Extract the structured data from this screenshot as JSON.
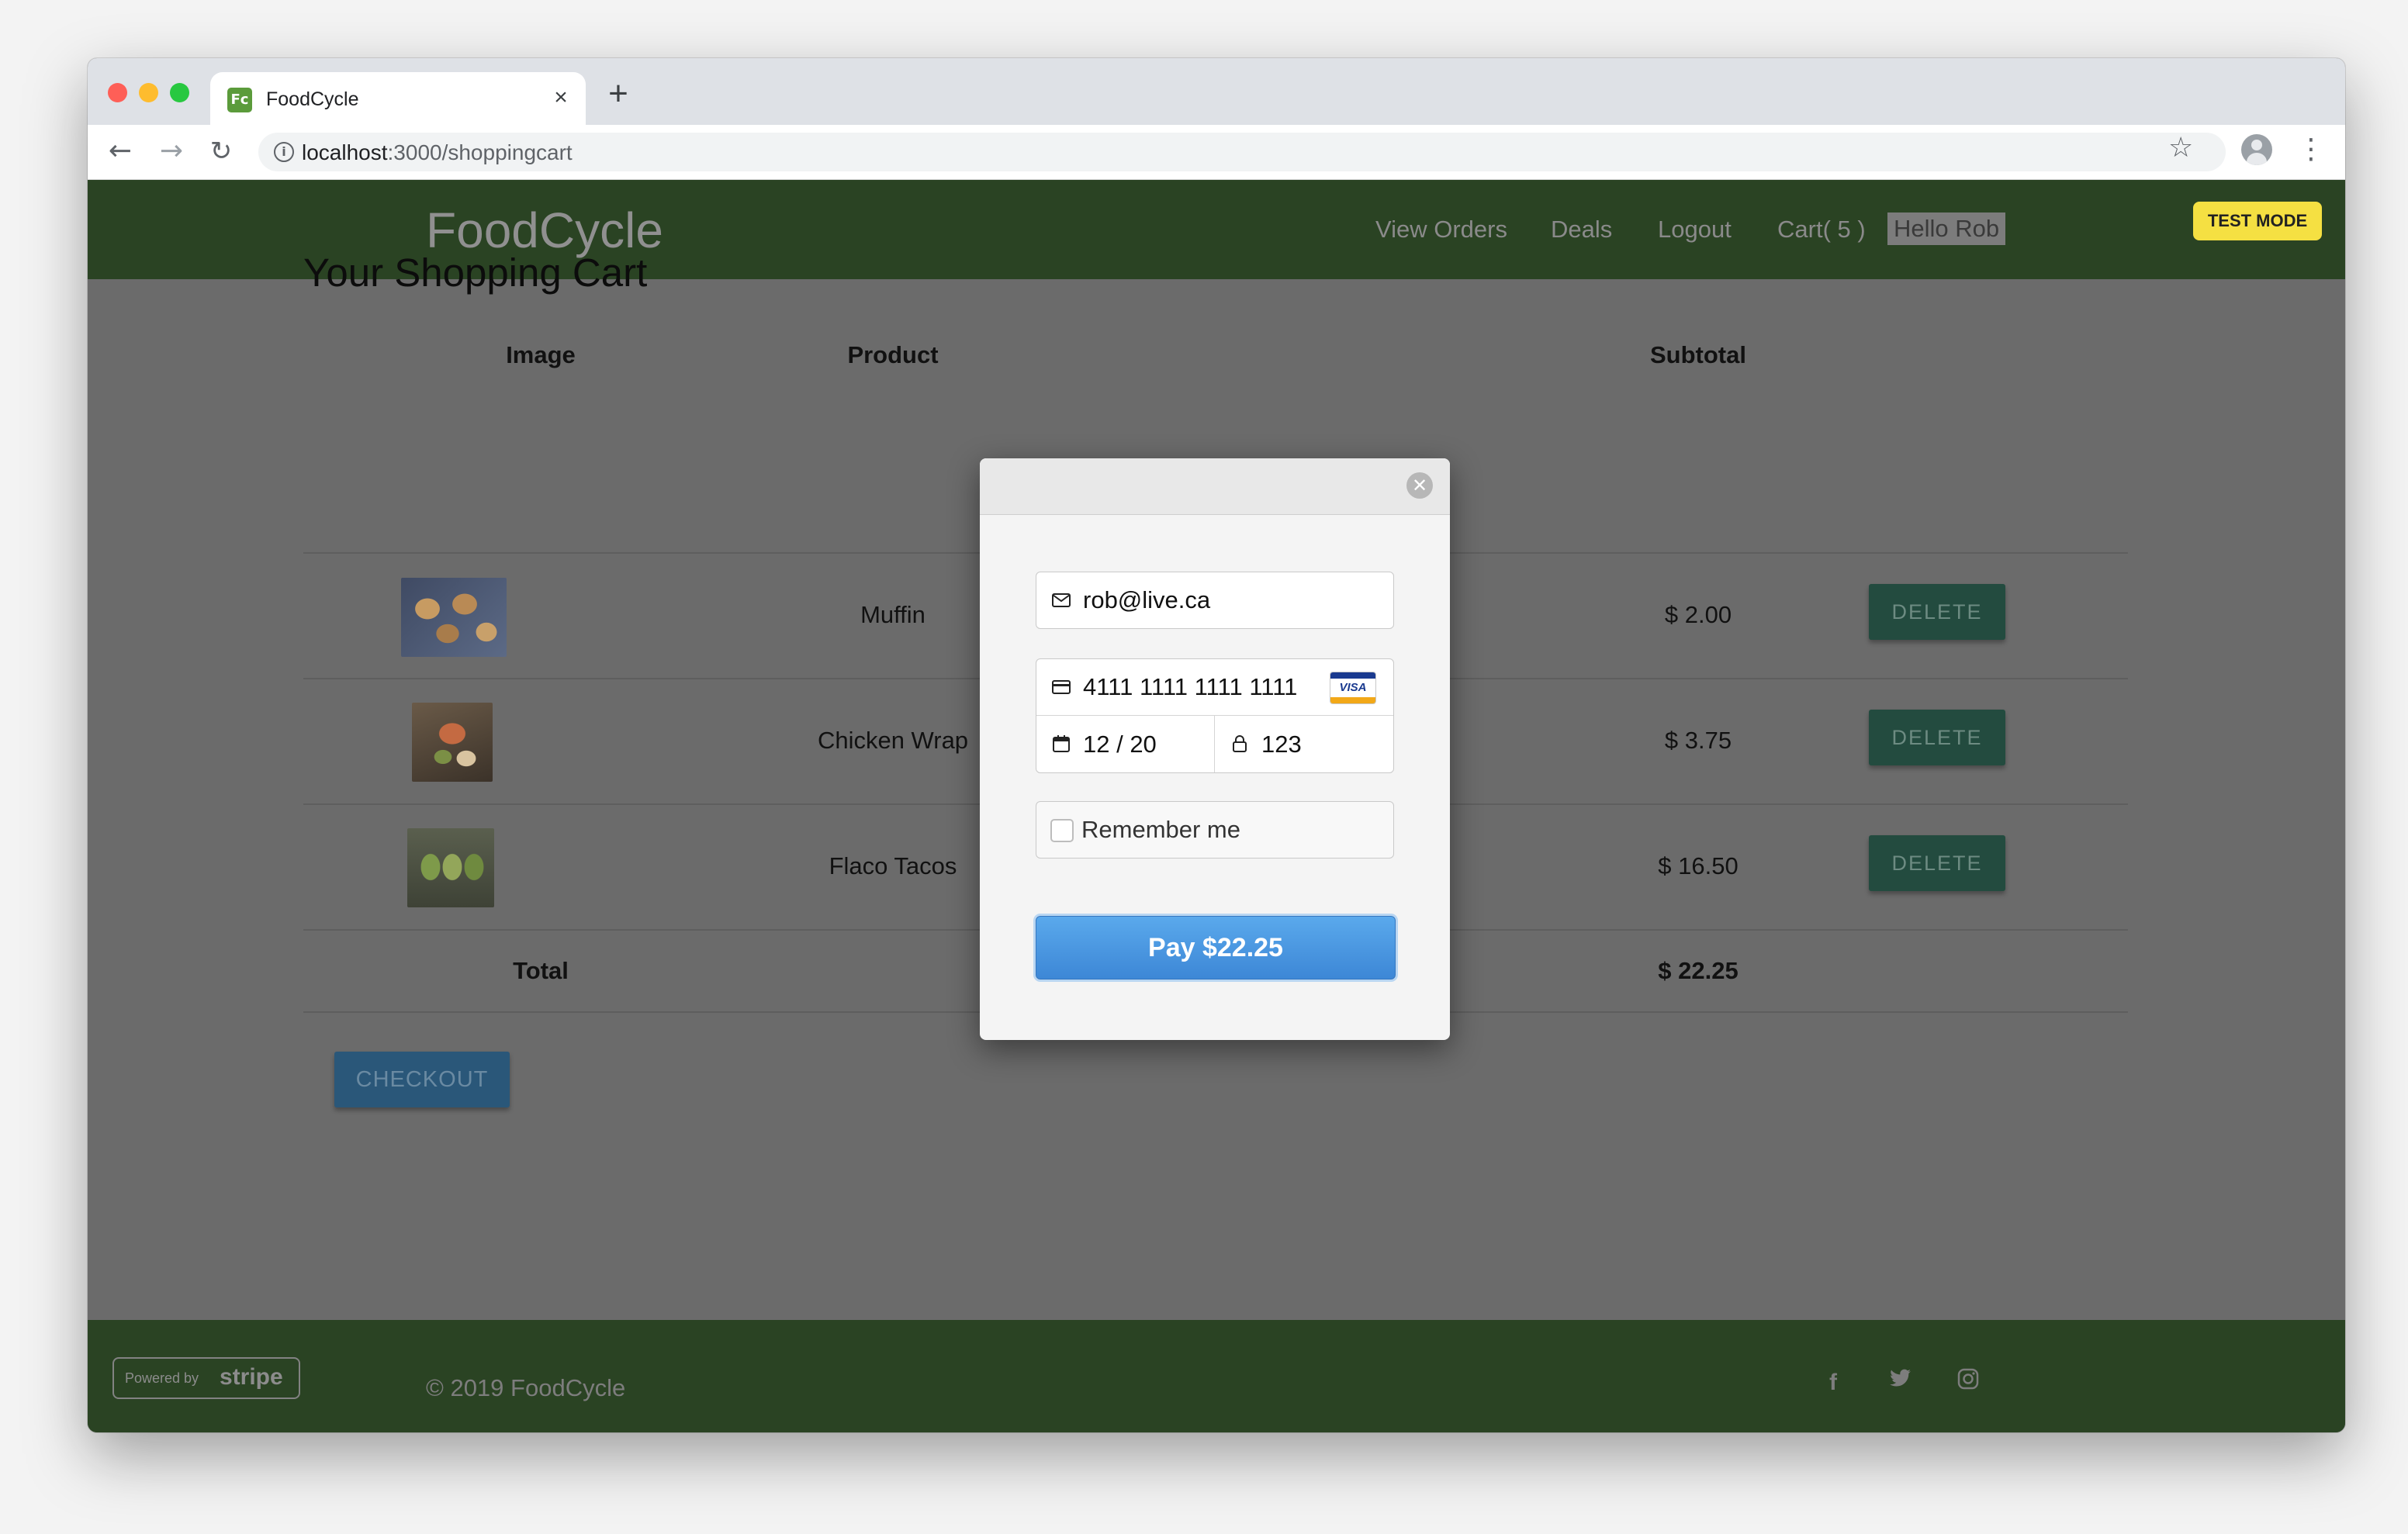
{
  "browser": {
    "tab_title": "FoodCycle",
    "favicon_text": "Fc",
    "tab_close": "×",
    "new_tab": "+",
    "url_host": "localhost",
    "url_path": ":3000/shoppingcart",
    "icons": [
      "back-arrow-icon",
      "forward-arrow-icon",
      "reload-icon",
      "info-icon",
      "star-icon",
      "profile-icon",
      "menu-dots-icon"
    ]
  },
  "navbar": {
    "brand": "FoodCycle",
    "links": [
      "View Orders",
      "Deals",
      "Logout",
      "Cart( 5 )"
    ],
    "greeting": "Hello Rob",
    "test_mode": "TEST MODE",
    "bg_color": "#2a4323"
  },
  "cart": {
    "title": "Your Shopping Cart",
    "headers": {
      "image": "Image",
      "product": "Product",
      "subtotal": "Subtotal"
    },
    "items": [
      {
        "product": "Muffin",
        "subtotal": "$ 2.00",
        "delete_label": "DELETE"
      },
      {
        "product": "Chicken Wrap",
        "subtotal": "$ 3.75",
        "delete_label": "DELETE"
      },
      {
        "product": "Flaco Tacos",
        "subtotal": "$ 16.50",
        "delete_label": "DELETE"
      }
    ],
    "total_label": "Total",
    "total_value": "$ 22.25",
    "checkout_label": "CHECKOUT"
  },
  "footer": {
    "powered_by": "Powered by",
    "stripe_wordmark": "stripe",
    "copyright": "© 2019 FoodCycle",
    "social_icons": [
      "facebook-icon",
      "twitter-icon",
      "instagram-icon"
    ]
  },
  "checkout_modal": {
    "close_symbol": "✕",
    "email": "rob@live.ca",
    "card_number": "4111 1111 1111 1111",
    "card_brand": "VISA",
    "expiry": "12 / 20",
    "cvc": "123",
    "remember_label": "Remember me",
    "pay_label": "Pay $22.25",
    "pay_color": "#4a99e2"
  }
}
